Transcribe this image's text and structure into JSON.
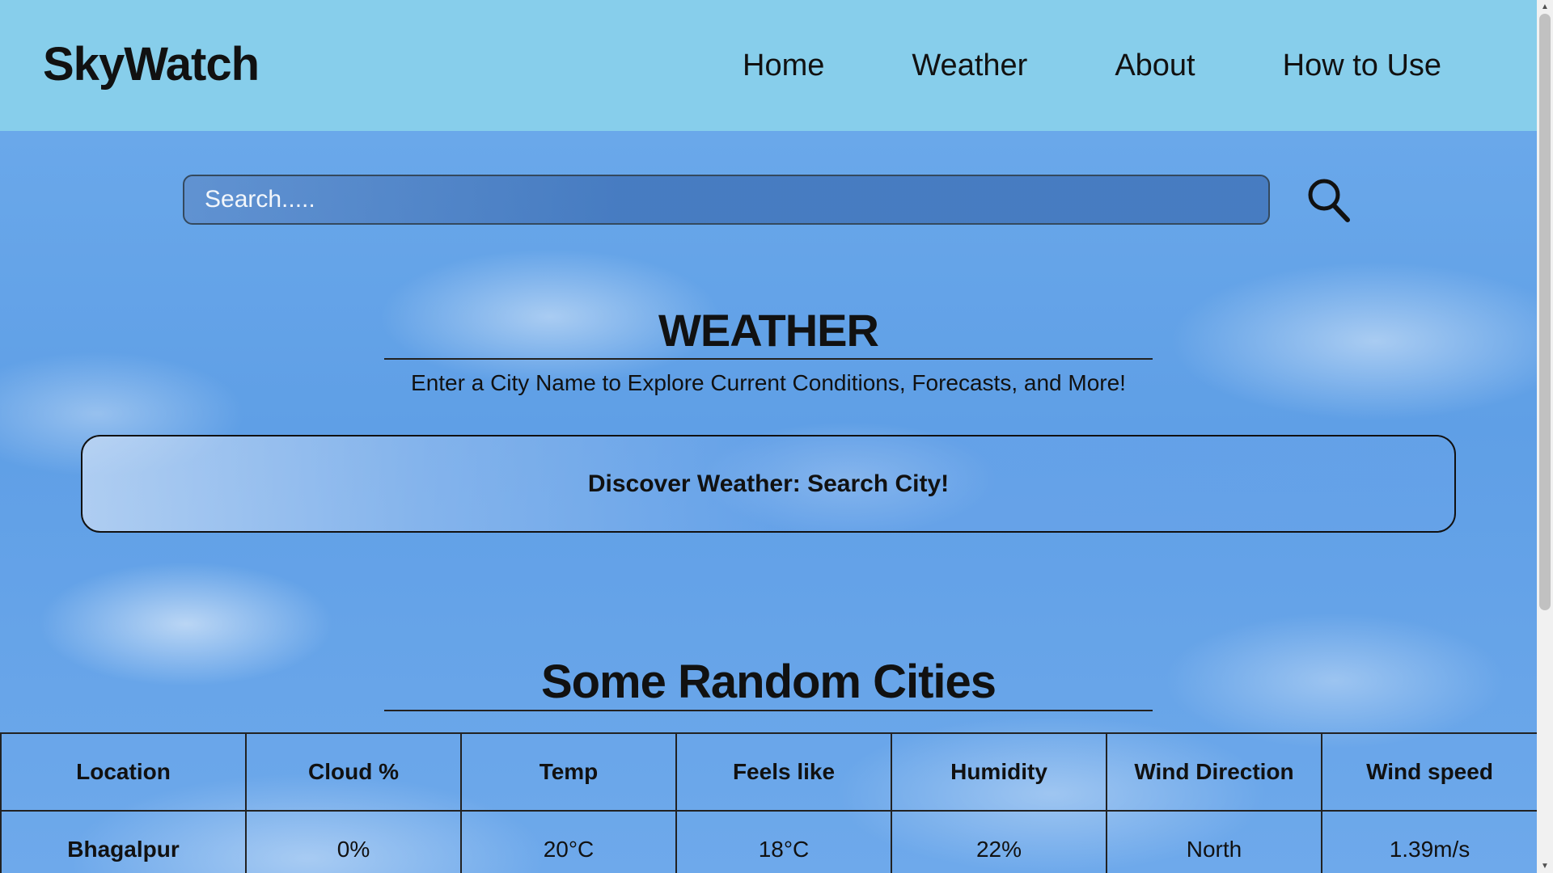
{
  "brand": "SkyWatch",
  "nav": [
    "Home",
    "Weather",
    "About",
    "How to Use"
  ],
  "search": {
    "placeholder": "Search....."
  },
  "weather_section": {
    "title": "WEATHER",
    "subtitle": "Enter a City Name to Explore Current Conditions, Forecasts, and More!",
    "discover": "Discover Weather: Search City!"
  },
  "cities_section": {
    "title": "Some Random Cities",
    "columns": [
      "Location",
      "Cloud %",
      "Temp",
      "Feels like",
      "Humidity",
      "Wind Direction",
      "Wind speed"
    ],
    "rows": [
      [
        "Bhagalpur",
        "0%",
        "20°C",
        "18°C",
        "22%",
        "North",
        "1.39m/s"
      ]
    ]
  },
  "icons": {
    "search": "search-icon"
  },
  "colors": {
    "header_bg": "#87ceeb",
    "sky": "#5f9fe6",
    "text": "#111111"
  }
}
